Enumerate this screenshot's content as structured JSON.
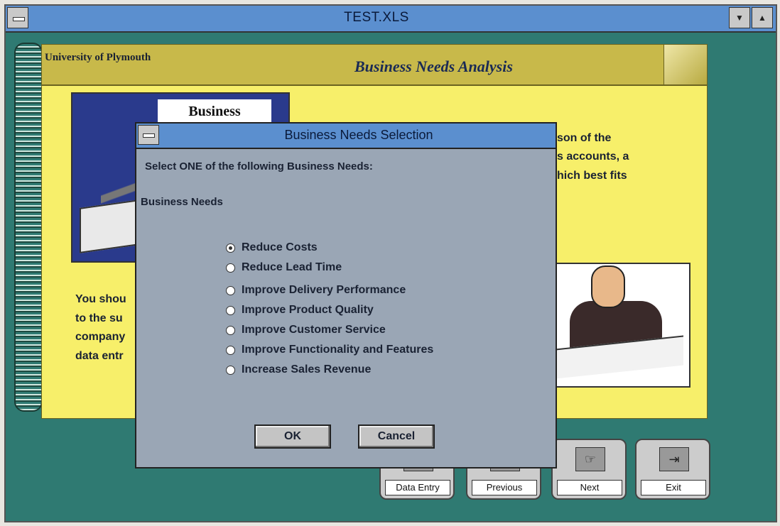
{
  "window": {
    "title": "TEST.XLS",
    "min_symbol": "▼",
    "max_symbol": "▲"
  },
  "banner": {
    "institution": "University of Plymouth",
    "heading": "Business Needs Analysis"
  },
  "page": {
    "picture_caption": "Business",
    "right_text": [
      "son of the",
      "s accounts, a",
      "hich best fits"
    ],
    "left_text": [
      "You shou",
      "to the su",
      "company",
      "data entr"
    ]
  },
  "nav": {
    "buttons": [
      {
        "label": "Data Entry",
        "icon": "clipboard-icon"
      },
      {
        "label": "Previous",
        "icon": "back-hand-icon"
      },
      {
        "label": "Next",
        "icon": "pointing-hand-icon"
      },
      {
        "label": "Exit",
        "icon": "exit-door-icon"
      }
    ]
  },
  "dialog": {
    "title": "Business Needs Selection",
    "prompt": "Select ONE of the following Business Needs:",
    "group_label": "Business Needs",
    "options": [
      "Reduce Costs",
      "Reduce Lead Time",
      "Improve Delivery Performance",
      "Improve Product Quality",
      "Improve Customer Service",
      "Improve Functionality and Features",
      "Increase Sales Revenue"
    ],
    "selected": "Reduce Costs",
    "ok_label": "OK",
    "cancel_label": "Cancel"
  }
}
